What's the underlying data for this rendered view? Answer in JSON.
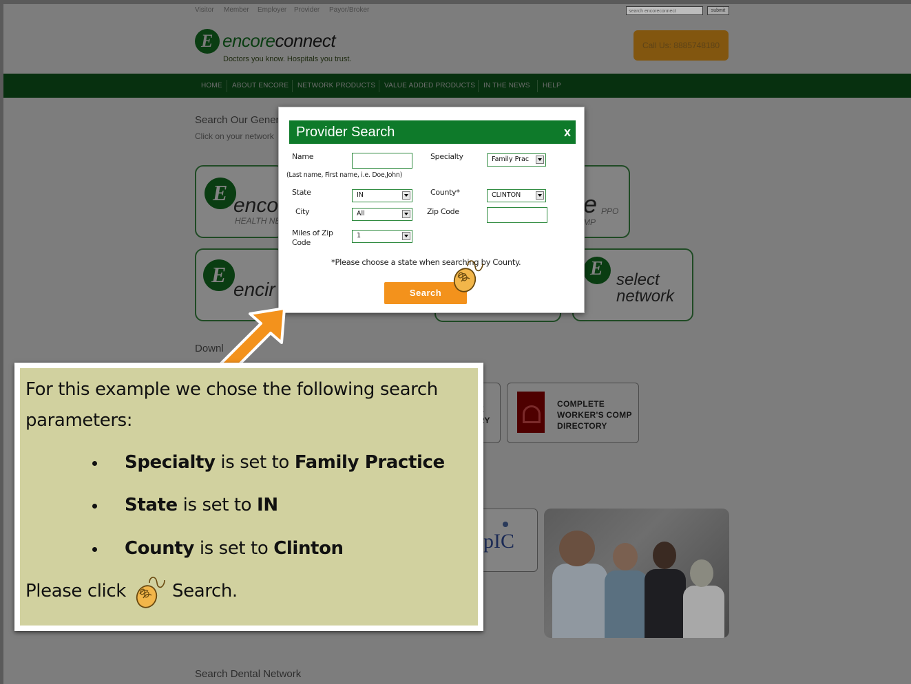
{
  "topbar": {
    "links": [
      "Visitor",
      "Member",
      "Employer",
      "Provider",
      "Payor/Broker"
    ],
    "search_placeholder": "search encoreconnect",
    "search_button": "submit"
  },
  "brand": {
    "name_part1": "encore",
    "name_part2": "connect",
    "tagline": "Doctors you know. Hospitals you trust.",
    "call_button": "Call Us: 8885748180"
  },
  "nav": {
    "items": [
      "HOME",
      "ABOUT ENCORE",
      "NETWORK PRODUCTS",
      "VALUE ADDED PRODUCTS",
      "IN THE NEWS",
      "HELP"
    ]
  },
  "page": {
    "search_heading": "Search Our Gener",
    "click_text": "Click on your network",
    "download_heading": "Downl",
    "dental_heading": "Search Dental Network"
  },
  "network_cards": {
    "card1_title": "enco",
    "card1_sub": "HEALTH NE",
    "card2_title": "e",
    "card2_sub1": "PPO",
    "card2_sub2": "MP",
    "card3_title": "encir",
    "card4_line1": "select",
    "card4_line2": "network"
  },
  "directory_cards": {
    "partial_text": "E\nRY",
    "workers_comp_line1": "COMPLETE",
    "workers_comp_line2": "WORKER'S COMP",
    "workers_comp_line3": "DIRECTORY"
  },
  "epic": {
    "logo_text": "pIC"
  },
  "modal": {
    "title": "Provider Search",
    "close": "x",
    "name_label": "Name",
    "name_hint": "(Last name, First name, i.e. Doe,John)",
    "name_value": "",
    "specialty_label": "Specialty",
    "specialty_value": "Family Prac",
    "state_label": "State",
    "state_value": "IN",
    "county_label": "County*",
    "county_value": "CLINTON",
    "city_label": "City",
    "city_value": "All",
    "zip_label": "Zip Code",
    "zip_value": "",
    "miles_label_line1": "Miles of Zip",
    "miles_label_line2": "Code",
    "miles_value": "1",
    "note": "*Please choose a state when searching by County.",
    "search_button": "Search"
  },
  "callout": {
    "intro_line1": "For this example we chose the following search",
    "intro_line2": "parameters:",
    "b1_field": "Specialty",
    "b1_mid": " is set to ",
    "b1_value": "Family Practice",
    "b2_field": "State",
    "b2_mid": " is set to ",
    "b2_value": "IN",
    "b3_field": "County",
    "b3_mid": " is set to ",
    "b3_value": "Clinton",
    "click_prefix": "Please click",
    "click_suffix": "Search."
  },
  "colors": {
    "modal_header": "#0e7a2a",
    "search_button": "#f3921c",
    "callout_bg": "#d1d19f",
    "nav_bg": "#07300f"
  },
  "icons": {
    "cursor": "hand-pointer-icon",
    "arrow": "arrow-up-right-icon"
  }
}
